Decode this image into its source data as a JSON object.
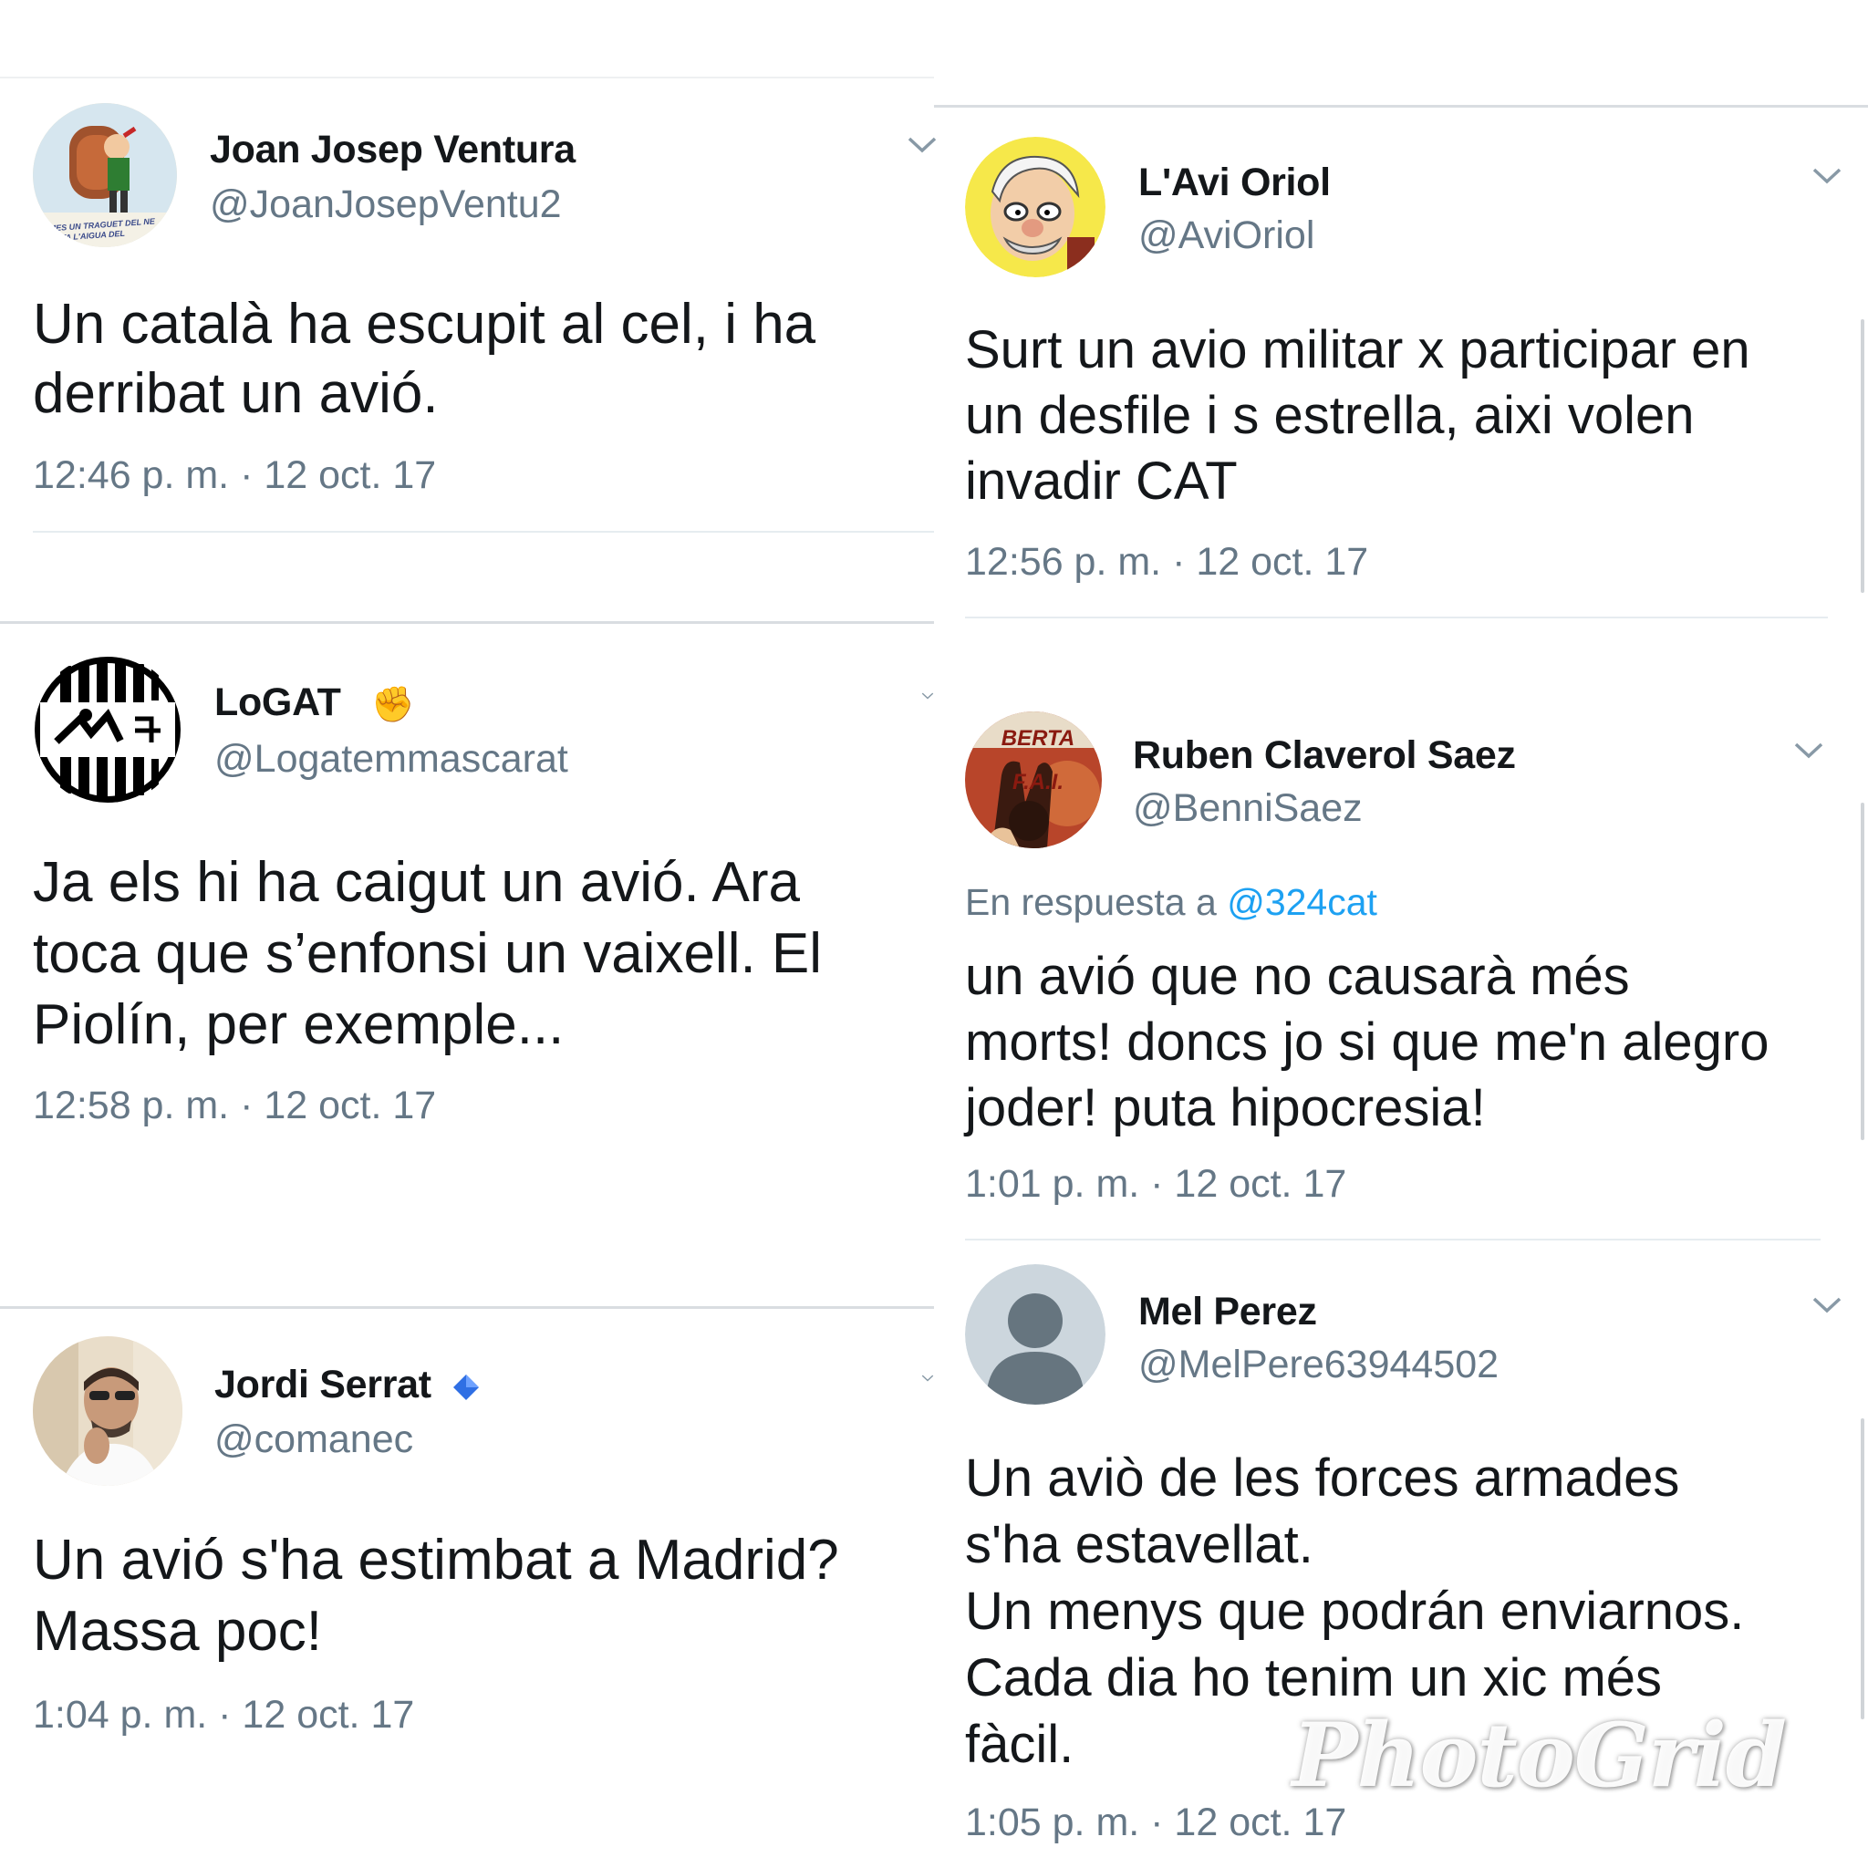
{
  "tweets": [
    {
      "name": "Joan Josep Ventura",
      "handle": "@JoanJosepVentu2",
      "text": "Un català ha escupit al cel, i ha\nderribat un avió.",
      "time": "12:46 p. m. · 12 oct. 17",
      "avatar_text": "MES UN TRAGUET DEL NE\nTOTA L'AIGUA DEL"
    },
    {
      "name": "LoGAT",
      "handle": "@Logatemmascarat",
      "text": "Ja els hi ha caigut un avió. Ara\ntoca que s’enfonsi un vaixell. El\nPiolín, per exemple...",
      "time": "12:58 p. m. · 12 oct. 17",
      "emoji": "✊"
    },
    {
      "name": "Jordi Serrat",
      "handle": "@comanec",
      "text": "Un avió s'ha estimbat a Madrid?\nMassa poc!",
      "time": "1:04 p. m. · 12 oct. 17"
    },
    {
      "name": "L'Avi Oriol",
      "handle": "@AviOriol",
      "text": "Surt un avio militar x participar en\nun desfile i s estrella, aixi volen\ninvadir CAT",
      "time": "12:56 p. m. · 12 oct. 17"
    },
    {
      "name": "Ruben Claverol Saez",
      "handle": "@BenniSaez",
      "reply_prefix": "En respuesta a",
      "reply_mention": "@324cat",
      "text": "un avió que no causarà més\nmorts! doncs jo si que me'n alegro\njoder! puta hipocresia!",
      "time": "1:01 p. m. · 12 oct. 17",
      "avatar_text": "BERTA\nF.A.I."
    },
    {
      "name": "Mel Perez",
      "handle": "@MelPere63944502",
      "text": "Un aviò de les forces armades\ns'ha estavellat.\nUn menys que podrán enviarnos.\nCada dia ho tenim un xic més\nfàcil.",
      "time": "1:05 p. m. · 12 oct. 17"
    }
  ],
  "watermark": "PhotoGrid",
  "colors": {
    "text": "#14171a",
    "secondary": "#657786",
    "link": "#1da1f2",
    "divider": "#d9dde1",
    "verified": "#2f6fe4"
  }
}
